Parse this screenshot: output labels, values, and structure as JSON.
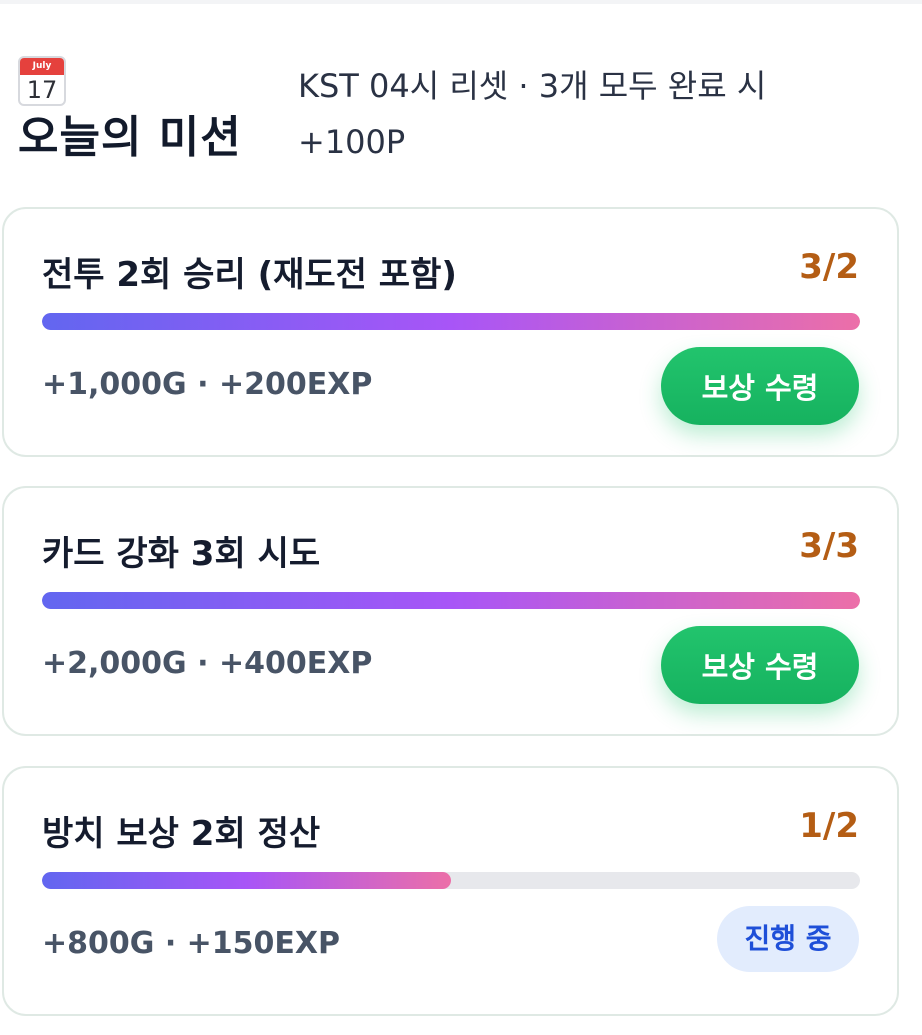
{
  "header": {
    "title": "오늘의 미션",
    "calendar_icon": {
      "name": "calendar-icon",
      "month": "July",
      "day": "17"
    },
    "subtitle": "KST 04시 리셋 · 3개 모두 완료 시 +100P"
  },
  "missions": [
    {
      "title": "전투 2회 승리 (재도전 포함)",
      "progress_text": "3/2",
      "progress_fraction": 1.0,
      "reward": "+1,000G · +200EXP",
      "action_label": "보상 수령",
      "state": "claimable"
    },
    {
      "title": "카드 강화 3회 시도",
      "progress_text": "3/3",
      "progress_fraction": 1.0,
      "reward": "+2,000G · +400EXP",
      "action_label": "보상 수령",
      "state": "claimable"
    },
    {
      "title": "방치 보상 2회 정산",
      "progress_text": "1/2",
      "progress_fraction": 0.5,
      "reward": "+800G · +150EXP",
      "action_label": "진행 중",
      "state": "in_progress"
    }
  ],
  "colors": {
    "count_text": "#b45d14",
    "claim_button": "#1fbd68",
    "in_progress_badge_bg": "#e2ecfd",
    "in_progress_badge_text": "#1e4fd8",
    "progress_gradient_start": "#6266f0",
    "progress_gradient_mid": "#a855f7",
    "progress_gradient_end": "#ec6fa8"
  }
}
